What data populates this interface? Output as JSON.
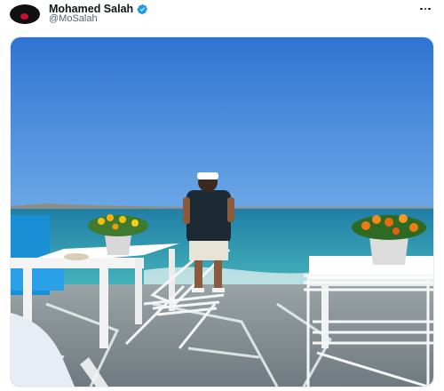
{
  "tweet": {
    "author": {
      "display_name": "Mohamed Salah",
      "handle": "@MoSalah",
      "verified": true,
      "avatar_icon": "profile-avatar"
    },
    "more_icon": "more-horizontal-icon",
    "media": {
      "kind": "photo",
      "alt_subject": "seaside terrace with white tables, folding chairs and flower pots"
    }
  },
  "colors": {
    "verified_blue": "#1d9bf0",
    "name_text": "#0f1419",
    "handle_text": "#536471",
    "sky": "#3f86dc",
    "sea": "#2f9db0"
  }
}
